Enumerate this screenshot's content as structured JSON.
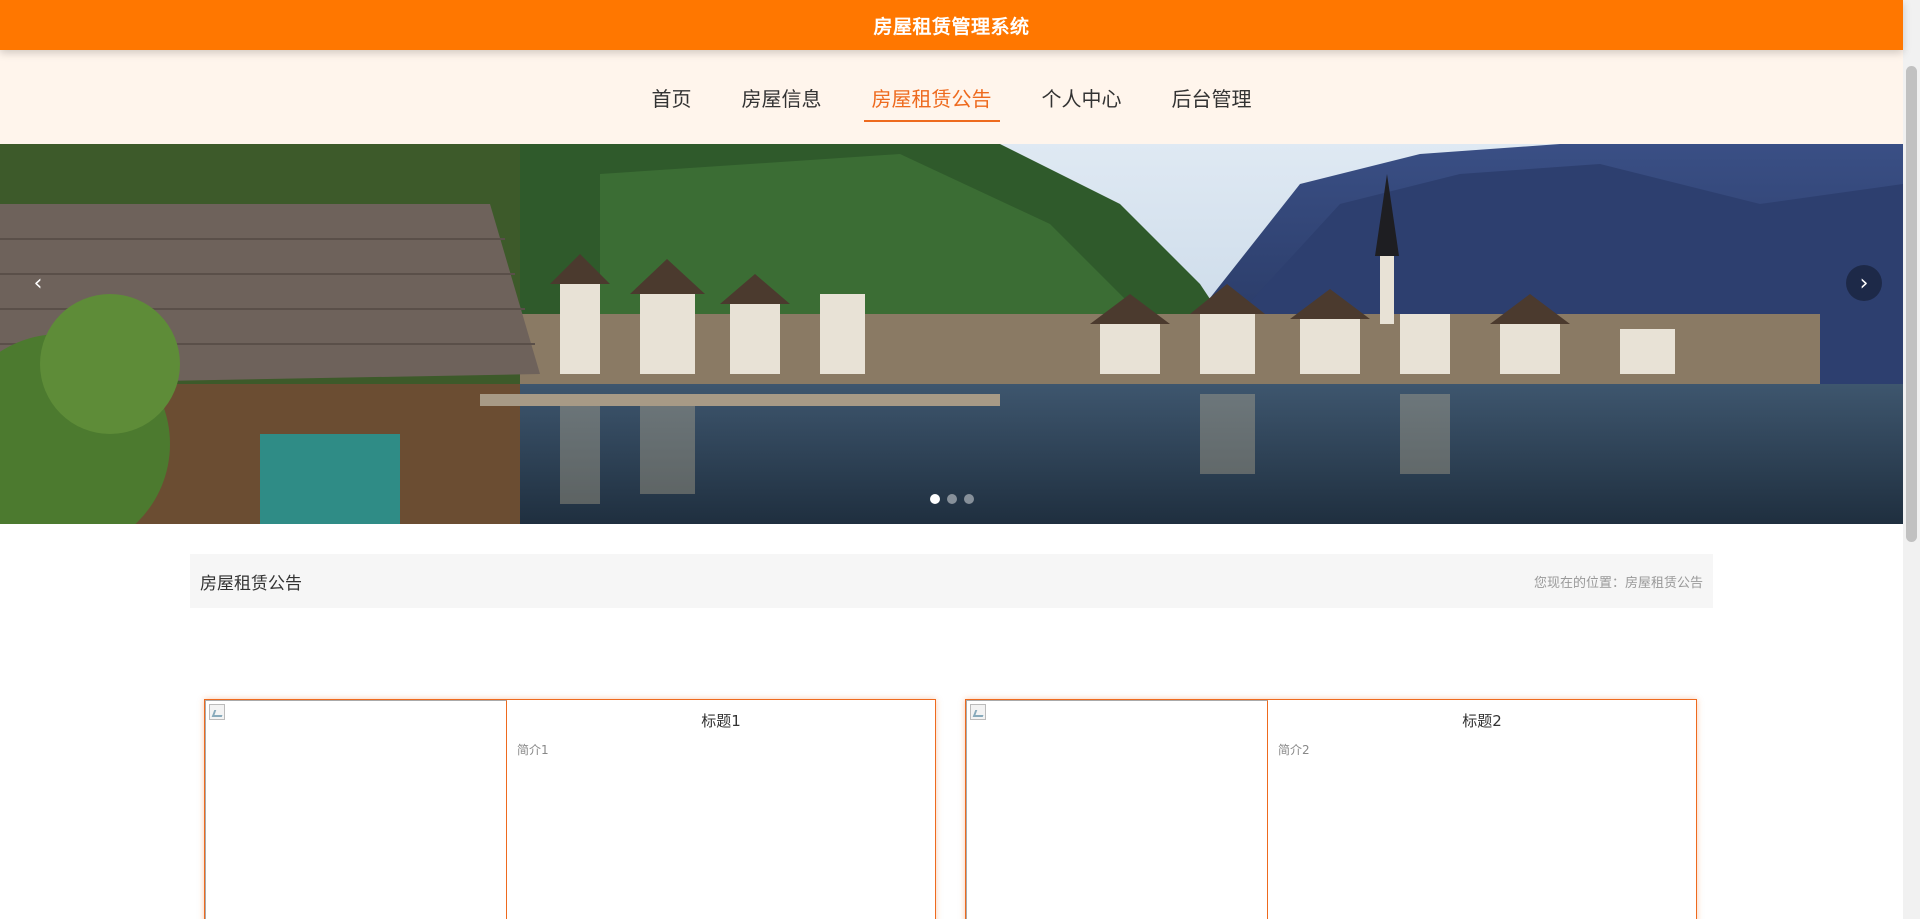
{
  "header": {
    "system_title": "房屋租赁管理系统"
  },
  "nav": {
    "items": [
      {
        "label": "首页"
      },
      {
        "label": "房屋信息"
      },
      {
        "label": "房屋租赁公告"
      },
      {
        "label": "个人中心"
      },
      {
        "label": "后台管理"
      }
    ],
    "active_index": 2
  },
  "banner": {
    "prev_symbol": "‹",
    "next_symbol": "›",
    "slide_count": 3,
    "active_slide": 0
  },
  "breadcrumb": {
    "title": "房屋租赁公告",
    "location": "您现在的位置：房屋租赁公告"
  },
  "cards": [
    {
      "title": "标题1",
      "brief": "简介1"
    },
    {
      "title": "标题2",
      "brief": "简介2"
    }
  ],
  "colors": {
    "accent": "#ff7700",
    "active_nav": "#ee6a1e",
    "nav_background": "#fff5ec"
  }
}
